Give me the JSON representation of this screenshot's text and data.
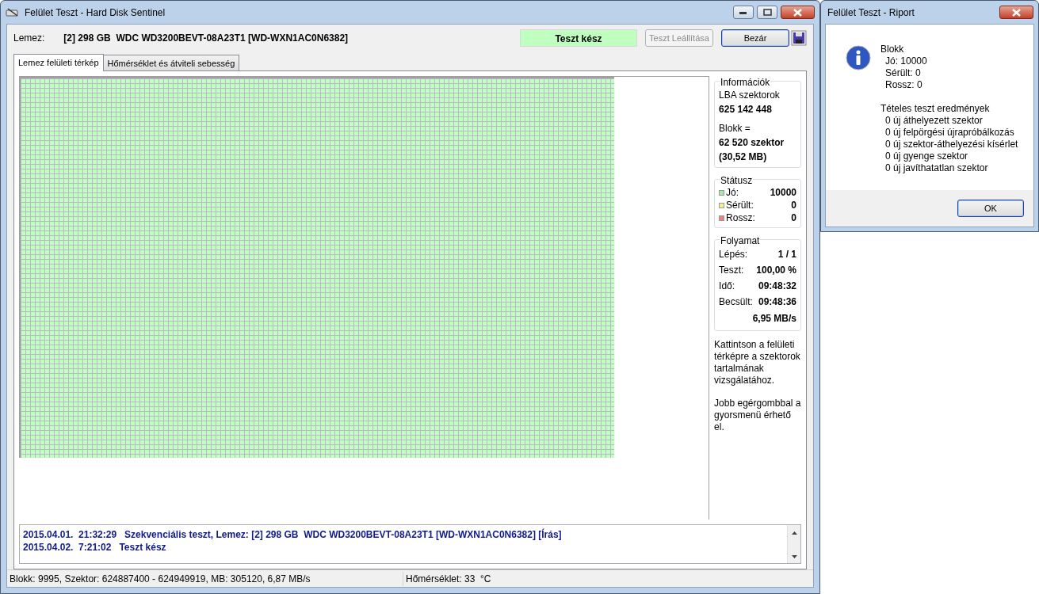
{
  "main_window": {
    "title": "Felület Teszt - Hard Disk Sentinel",
    "disk_label": "Lemez:",
    "disk_value": "[2] 298 GB  WDC WD3200BEVT-08A23T1 [WD-WXN1AC0N6382]",
    "test_status": "Teszt kész",
    "buttons": [
      {
        "label": "Teszt Leállítása",
        "disabled": true
      },
      {
        "label": "Bezár",
        "disabled": false
      }
    ],
    "tabs": [
      {
        "label": "Lemez felületi térkép",
        "selected": true
      },
      {
        "label": "Hőmérséklet és átviteli sebesség",
        "selected": false
      }
    ],
    "info": {
      "title": "Információk",
      "lba_label": "LBA szektorok",
      "lba_value": "625 142 448",
      "block_label": "Blokk =",
      "block_value": "62 520 szektor",
      "block_size": "(30,52 MB)"
    },
    "status_group": {
      "title": "Státusz",
      "rows": [
        {
          "label": "Jó:",
          "value": "10000",
          "color": "#a8e8a8"
        },
        {
          "label": "Sérült:",
          "value": "0",
          "color": "#f0f090"
        },
        {
          "label": "Rossz:",
          "value": "0",
          "color": "#f08080"
        }
      ]
    },
    "progress": {
      "title": "Folyamat",
      "rows": [
        {
          "label": "Lépés:",
          "value": "1 / 1"
        },
        {
          "label": "Teszt:",
          "value": "100,00 %"
        },
        {
          "label": "Idő:",
          "value": "09:48:32"
        },
        {
          "label": "Becsült:",
          "value": "09:48:36"
        }
      ],
      "speed": "6,95 MB/s"
    },
    "hints": [
      "Kattintson a felületi térképre a szektorok tartalmának vizsgálatához.",
      "Jobb egérgombbal a gyorsmenü érhető el."
    ],
    "log": [
      {
        "date": "2015.04.01.",
        "time": "21:32:29",
        "message": "Szekvenciális teszt, Lemez: [2] 298 GB  WDC WD3200BEVT-08A23T1 [WD-WXN1AC0N6382] [Írás]"
      },
      {
        "date": "2015.04.02.",
        "time": "7:21:02",
        "message": "Teszt kész"
      }
    ],
    "status_bar": [
      "Blokk: 9995, Szektor: 624887400 - 624949919, MB: 305120, 6,87 MB/s",
      "Hőmérséklet: 33  °C"
    ]
  },
  "report_dialog": {
    "title": "Felület Teszt - Riport",
    "sections": [
      {
        "heading": "Blokk",
        "items": [
          "Jó: 10000",
          "Sérült: 0",
          "Rossz: 0"
        ]
      },
      {
        "heading": "Tételes teszt eredmények",
        "items": [
          "0 új áthelyezett szektor",
          "0 új felpörgési újrapróbálkozás",
          "0 új szektor-áthelyezési kísérlet",
          "0 új gyenge szektor",
          "0 új javíthatatlan szektor"
        ]
      }
    ],
    "button": "OK"
  }
}
